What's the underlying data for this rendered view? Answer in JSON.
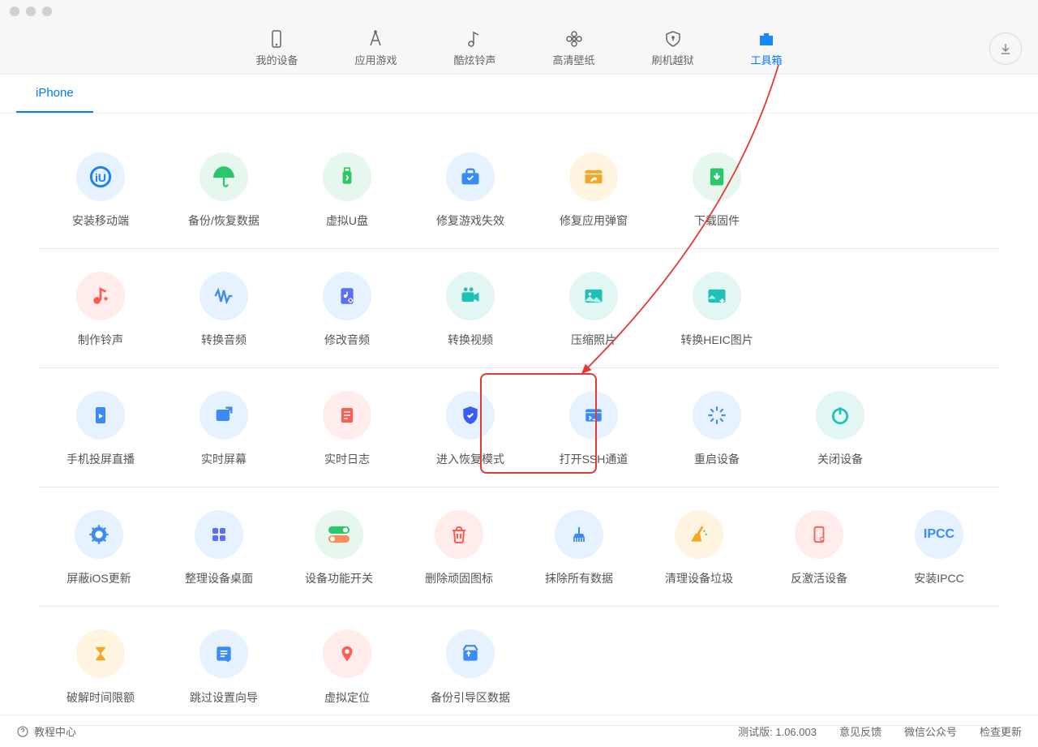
{
  "nav": {
    "my_device": "我的设备",
    "app_games": "应用游戏",
    "ringtones": "酷炫铃声",
    "wallpaper": "高清壁纸",
    "flash_jb": "刷机越狱",
    "toolbox": "工具箱"
  },
  "subtab": {
    "iphone": "iPhone"
  },
  "tools": {
    "r1": {
      "install_mobile": "安装移动端",
      "backup_restore": "备份/恢复数据",
      "virtual_u": "虚拟U盘",
      "fix_game": "修复游戏失效",
      "fix_popup": "修复应用弹窗",
      "download_fw": "下载固件"
    },
    "r2": {
      "make_ringtone": "制作铃声",
      "convert_audio": "转换音频",
      "edit_audio": "修改音频",
      "convert_video": "转换视频",
      "compress_photo": "压缩照片",
      "convert_heic": "转换HEIC图片"
    },
    "r3": {
      "screen_cast": "手机投屏直播",
      "realtime_screen": "实时屏幕",
      "realtime_log": "实时日志",
      "recovery_mode": "进入恢复模式",
      "open_ssh": "打开SSH通道",
      "restart": "重启设备",
      "shutdown": "关闭设备"
    },
    "r4": {
      "block_update": "屏蔽iOS更新",
      "arrange_desktop": "整理设备桌面",
      "feature_switch": "设备功能开关",
      "delete_stubborn": "删除顽固图标",
      "erase_all": "抹除所有数据",
      "clean_junk": "清理设备垃圾",
      "deactivate": "反激活设备",
      "install_ipcc": "安装IPCC"
    },
    "r5": {
      "time_limit": "破解时间限额",
      "skip_setup": "跳过设置向导",
      "virtual_location": "虚拟定位",
      "backup_boot": "备份引导区数据"
    }
  },
  "footer": {
    "tutorial": "教程中心",
    "version": "测试版: 1.06.003",
    "feedback": "意见反馈",
    "wechat": "微信公众号",
    "check_update": "检查更新"
  },
  "colors": {
    "primary": "#007aff",
    "highlight": "#e53935"
  },
  "ipcc_label": "IPCC"
}
